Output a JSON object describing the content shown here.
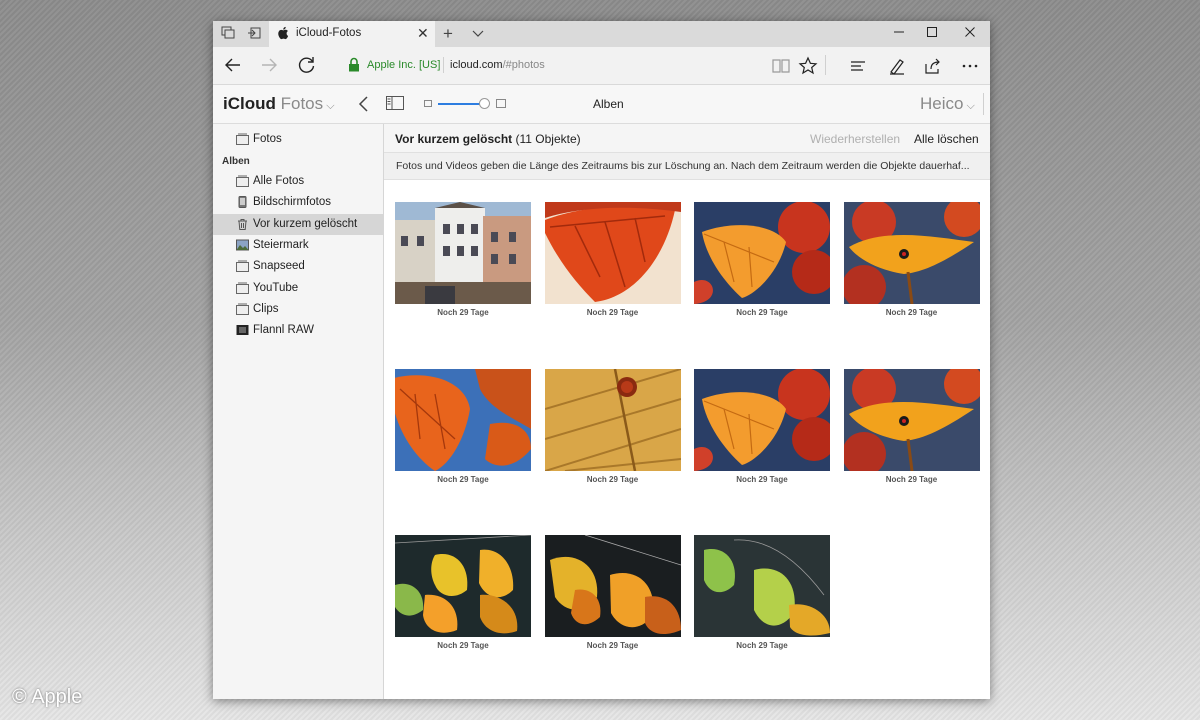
{
  "browser": {
    "tab_title": "iCloud-Fotos",
    "new_tab": "+",
    "cert_label": "Apple Inc. [US]",
    "url_domain": "icloud.com",
    "url_path": "/#photos"
  },
  "app": {
    "brand": "iCloud",
    "section": "Fotos",
    "header_title": "Alben",
    "user": "Heico"
  },
  "sidebar": {
    "top_item": {
      "label": "Fotos",
      "icon": "album-icon"
    },
    "heading": "Alben",
    "items": [
      {
        "label": "Alle Fotos",
        "icon": "album-icon",
        "selected": false
      },
      {
        "label": "Bildschirmfotos",
        "icon": "phone-icon",
        "selected": false
      },
      {
        "label": "Vor kurzem gelöscht",
        "icon": "trash-icon",
        "selected": true
      },
      {
        "label": "Steiermark",
        "icon": "thumbnail-icon",
        "selected": false
      },
      {
        "label": "Snapseed",
        "icon": "album-icon",
        "selected": false
      },
      {
        "label": "YouTube",
        "icon": "album-icon",
        "selected": false
      },
      {
        "label": "Clips",
        "icon": "album-icon",
        "selected": false
      },
      {
        "label": "Flannl RAW",
        "icon": "film-icon",
        "selected": false
      }
    ]
  },
  "main": {
    "title": "Vor kurzem gelöscht",
    "count": "(11 Objekte)",
    "restore_label": "Wiederherstellen",
    "delete_all_label": "Alle löschen",
    "info_text": "Fotos und Videos geben die Länge des Zeitraums bis zur Löschung an. Nach dem Zeitraum werden die Objekte dauerhaf..."
  },
  "photos": [
    {
      "caption": "Noch 29 Tage",
      "subject": "buildings"
    },
    {
      "caption": "Noch 29 Tage",
      "subject": "red-leaf"
    },
    {
      "caption": "Noch 29 Tage",
      "subject": "orange-leaf"
    },
    {
      "caption": "Noch 29 Tage",
      "subject": "ladybug-leaf"
    },
    {
      "caption": "Noch 29 Tage",
      "subject": "leaf-sky"
    },
    {
      "caption": "Noch 29 Tage",
      "subject": "leaf-closeup"
    },
    {
      "caption": "Noch 29 Tage",
      "subject": "orange-leaf"
    },
    {
      "caption": "Noch 29 Tage",
      "subject": "ladybug-leaf"
    },
    {
      "caption": "Noch 29 Tage",
      "subject": "green-yellow-leaves"
    },
    {
      "caption": "Noch 29 Tage",
      "subject": "yellow-leaves"
    },
    {
      "caption": "Noch 29 Tage",
      "subject": "green-leaves"
    }
  ],
  "watermark": "© Apple",
  "colors": {
    "accent": "#2d7de0",
    "secure": "#2a8a2a",
    "selected_bg": "#d6d6d6"
  }
}
